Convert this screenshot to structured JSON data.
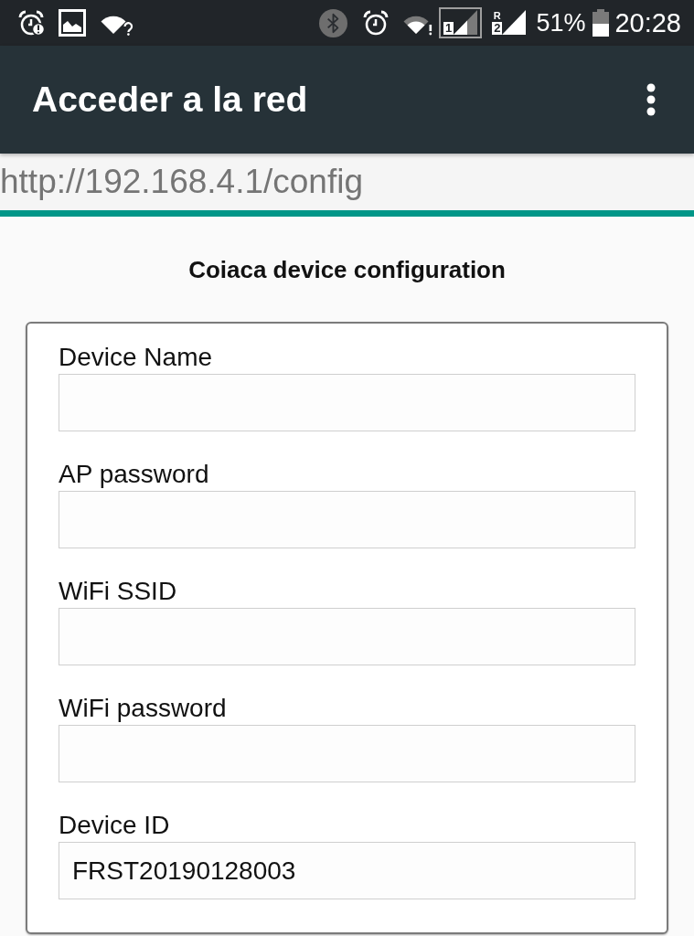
{
  "status_bar": {
    "sims": [
      {
        "number": "1",
        "highlighted": true
      },
      {
        "number": "2",
        "roaming": "R",
        "highlighted": false
      }
    ],
    "battery": "51%",
    "time": "20:28"
  },
  "app_bar": {
    "title": "Acceder a la red"
  },
  "address_bar": {
    "url": "http://192.168.4.1/config",
    "progress": {
      "level": 1
    }
  },
  "form": {
    "title": "Coiaca device configuration",
    "fields": [
      {
        "label": "Device Name"
      },
      {
        "label": "AP password"
      },
      {
        "label": "WiFi SSID"
      },
      {
        "label": "WiFi password"
      },
      {
        "label": "Device ID",
        "value": "FRST20190128003"
      }
    ]
  }
}
